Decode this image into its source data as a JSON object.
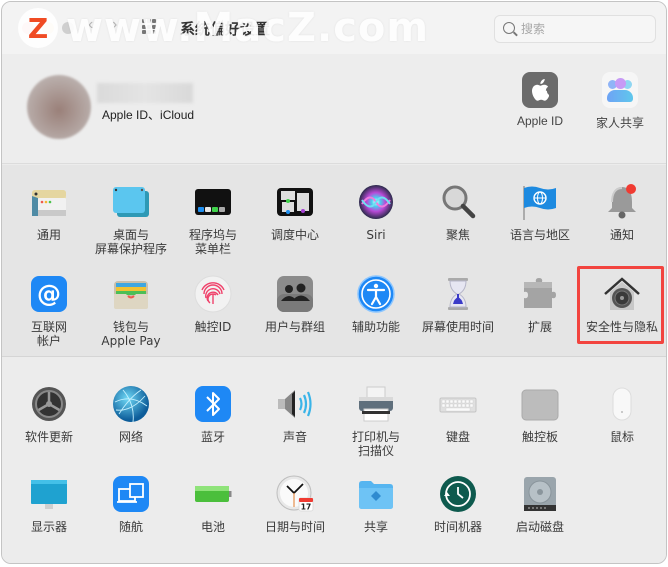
{
  "window": {
    "title": "系统偏好设置",
    "nav_back": "‹",
    "nav_forward": "›"
  },
  "watermark": {
    "logo": "Z",
    "text": "www.MacZ.com"
  },
  "search": {
    "placeholder": "搜索",
    "value": ""
  },
  "account": {
    "subtitle": "Apple ID、iCloud",
    "items": [
      {
        "label": "Apple ID",
        "icon": "apple-logo-icon"
      },
      {
        "label": "家人共享",
        "icon": "family-sharing-icon"
      }
    ]
  },
  "section1": {
    "rows": [
      [
        {
          "label": "通用",
          "icon": "general-icon"
        },
        {
          "label": "桌面与\n屏幕保护程序",
          "icon": "desktop-screensaver-icon"
        },
        {
          "label": "程序坞与\n菜单栏",
          "icon": "dock-menubar-icon"
        },
        {
          "label": "调度中心",
          "icon": "mission-control-icon"
        },
        {
          "label": "Siri",
          "icon": "siri-icon"
        },
        {
          "label": "聚焦",
          "icon": "spotlight-icon"
        },
        {
          "label": "语言与地区",
          "icon": "language-region-icon"
        },
        {
          "label": "通知",
          "icon": "notifications-icon"
        }
      ],
      [
        {
          "label": "互联网\n帐户",
          "icon": "internet-accounts-icon"
        },
        {
          "label": "钱包与\nApple Pay",
          "icon": "wallet-applepay-icon"
        },
        {
          "label": "触控ID",
          "icon": "touch-id-icon"
        },
        {
          "label": "用户与群组",
          "icon": "users-groups-icon"
        },
        {
          "label": "辅助功能",
          "icon": "accessibility-icon"
        },
        {
          "label": "屏幕使用时间",
          "icon": "screen-time-icon"
        },
        {
          "label": "扩展",
          "icon": "extensions-icon"
        },
        {
          "label": "安全性与隐私",
          "icon": "security-privacy-icon",
          "highlighted": true
        }
      ]
    ]
  },
  "section2": {
    "rows": [
      [
        {
          "label": "软件更新",
          "icon": "software-update-icon"
        },
        {
          "label": "网络",
          "icon": "network-icon"
        },
        {
          "label": "蓝牙",
          "icon": "bluetooth-icon"
        },
        {
          "label": "声音",
          "icon": "sound-icon"
        },
        {
          "label": "打印机与\n扫描仪",
          "icon": "printers-scanners-icon"
        },
        {
          "label": "键盘",
          "icon": "keyboard-icon"
        },
        {
          "label": "触控板",
          "icon": "trackpad-icon"
        },
        {
          "label": "鼠标",
          "icon": "mouse-icon"
        }
      ],
      [
        {
          "label": "显示器",
          "icon": "displays-icon"
        },
        {
          "label": "随航",
          "icon": "sidecar-icon"
        },
        {
          "label": "电池",
          "icon": "battery-icon"
        },
        {
          "label": "日期与时间",
          "icon": "date-time-icon"
        },
        {
          "label": "共享",
          "icon": "sharing-icon"
        },
        {
          "label": "时间机器",
          "icon": "time-machine-icon"
        },
        {
          "label": "启动磁盘",
          "icon": "startup-disk-icon"
        }
      ]
    ]
  },
  "date_icon_day": "17",
  "colors": {
    "highlight": "#f2443f",
    "accent_blue": "#1e88f5"
  }
}
